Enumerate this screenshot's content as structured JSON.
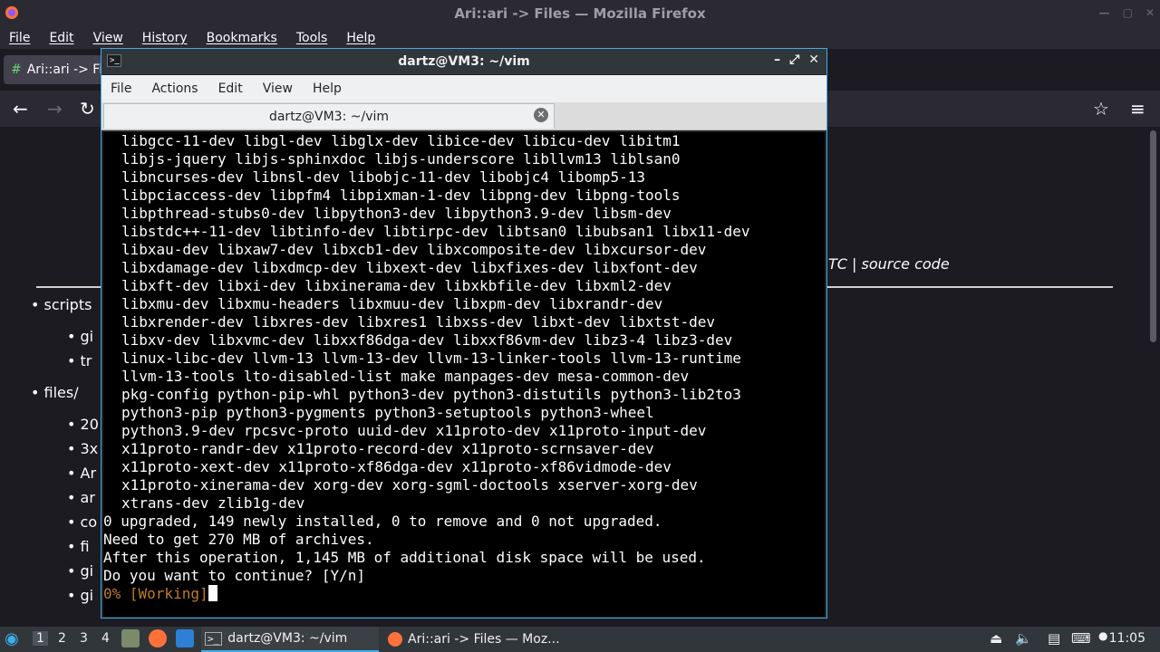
{
  "firefox": {
    "window_title": "Ari::ari -> Files — Mozilla Firefox",
    "menu": [
      "File",
      "Edit",
      "View",
      "History",
      "Bookmarks",
      "Tools",
      "Help"
    ],
    "tab_label": "Ari::ari -> Fi",
    "content": {
      "source_links": "TC | source code",
      "items": [
        {
          "level": 1,
          "text": "• scripts"
        },
        {
          "level": 2,
          "text": "• gi"
        },
        {
          "level": 2,
          "text": "• tr"
        },
        {
          "level": 1,
          "text": "• files/"
        },
        {
          "level": 2,
          "text": "• 20"
        },
        {
          "level": 2,
          "text": "• 3x"
        },
        {
          "level": 2,
          "text": "• Ar"
        },
        {
          "level": 2,
          "text": "• ar"
        },
        {
          "level": 2,
          "text": "• co"
        },
        {
          "level": 2,
          "text": "• fi"
        },
        {
          "level": 2,
          "text": "• gi"
        },
        {
          "level": 2,
          "text": "• gi"
        }
      ]
    }
  },
  "terminal": {
    "window_title": "dartz@VM3: ~/vim",
    "menu": [
      "File",
      "Actions",
      "Edit",
      "View",
      "Help"
    ],
    "tab_title": "dartz@VM3: ~/vim",
    "package_lines": [
      "libgcc-11-dev libgl-dev libglx-dev libice-dev libicu-dev libitm1",
      "libjs-jquery libjs-sphinxdoc libjs-underscore libllvm13 liblsan0",
      "libncurses-dev libnsl-dev libobjc-11-dev libobjc4 libomp5-13",
      "libpciaccess-dev libpfm4 libpixman-1-dev libpng-dev libpng-tools",
      "libpthread-stubs0-dev libpython3-dev libpython3.9-dev libsm-dev",
      "libstdc++-11-dev libtinfo-dev libtirpc-dev libtsan0 libubsan1 libx11-dev",
      "libxau-dev libxaw7-dev libxcb1-dev libxcomposite-dev libxcursor-dev",
      "libxdamage-dev libxdmcp-dev libxext-dev libxfixes-dev libxfont-dev",
      "libxft-dev libxi-dev libxinerama-dev libxkbfile-dev libxml2-dev",
      "libxmu-dev libxmu-headers libxmuu-dev libxpm-dev libxrandr-dev",
      "libxrender-dev libxres-dev libxres1 libxss-dev libxt-dev libxtst-dev",
      "libxv-dev libxvmc-dev libxxf86dga-dev libxxf86vm-dev libz3-4 libz3-dev",
      "linux-libc-dev llvm-13 llvm-13-dev llvm-13-linker-tools llvm-13-runtime",
      "llvm-13-tools lto-disabled-list make manpages-dev mesa-common-dev",
      "pkg-config python-pip-whl python3-dev python3-distutils python3-lib2to3",
      "python3-pip python3-pygments python3-setuptools python3-wheel",
      "python3.9-dev rpcsvc-proto uuid-dev x11proto-dev x11proto-input-dev",
      "x11proto-randr-dev x11proto-record-dev x11proto-scrnsaver-dev",
      "x11proto-xext-dev x11proto-xf86dga-dev x11proto-xf86vidmode-dev",
      "x11proto-xinerama-dev xorg-dev xorg-sgml-doctools xserver-xorg-dev",
      "xtrans-dev zlib1g-dev"
    ],
    "summary_lines": [
      "0 upgraded, 149 newly installed, 0 to remove and 0 not upgraded.",
      "Need to get 270 MB of archives.",
      "After this operation, 1,145 MB of additional disk space will be used.",
      "Do you want to continue? [Y/n]"
    ],
    "progress_line": "0% [Working]"
  },
  "taskbar": {
    "workspaces": [
      "1",
      "2",
      "3",
      "4"
    ],
    "tasks": [
      "dartz@VM3: ~/vim",
      "Ari::ari -> Files — Moz..."
    ],
    "clock": "11:05"
  }
}
